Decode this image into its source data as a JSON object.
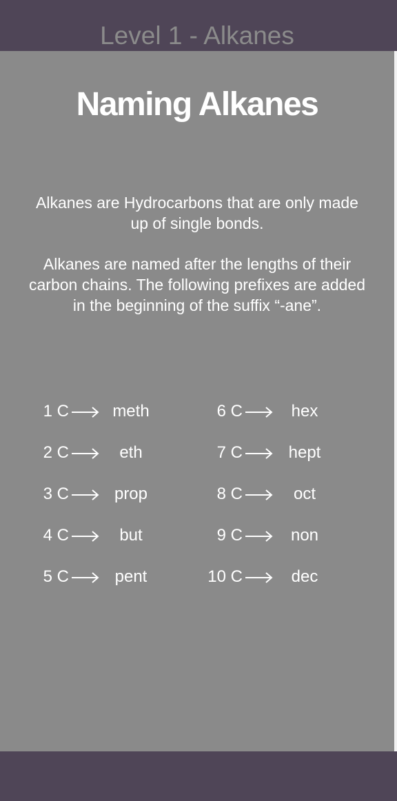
{
  "header": {
    "level_title": "Level 1 - Alkanes"
  },
  "main": {
    "heading": "Naming Alkanes",
    "paragraph_1": "Alkanes are Hydrocarbons that are only made up of single bonds.",
    "paragraph_2": "Alkanes are named after the lengths of their carbon chains. The following prefixes are added in the beginning of the suffix “-ane”.",
    "prefixes": [
      {
        "count": "1 C",
        "name": "meth"
      },
      {
        "count": "2 C",
        "name": "eth"
      },
      {
        "count": "3 C",
        "name": "prop"
      },
      {
        "count": "4 C",
        "name": "but"
      },
      {
        "count": "5 C",
        "name": "pent"
      },
      {
        "count": "6 C",
        "name": "hex"
      },
      {
        "count": "7 C",
        "name": "hept"
      },
      {
        "count": "8 C",
        "name": "oct"
      },
      {
        "count": "9 C",
        "name": "non"
      },
      {
        "count": "10 C",
        "name": "dec"
      }
    ]
  },
  "colors": {
    "bar": "#4f4557",
    "content_background": "#8a8a8a",
    "level_title_text": "#8b8b8b",
    "text": "#ffffff"
  },
  "icons": {
    "arrow": "right-arrow-icon"
  }
}
